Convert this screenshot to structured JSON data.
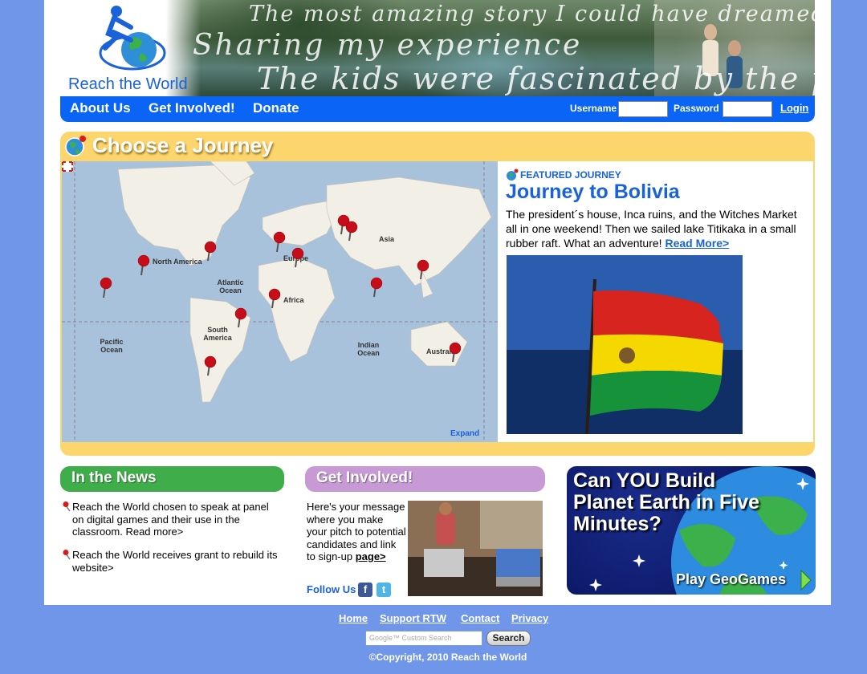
{
  "brand": {
    "name": "Reach the World"
  },
  "banner": {
    "tagline_1": "The most amazing story I could have dreamed of",
    "tagline_2": "Sharing my experience",
    "tagline_3": "The kids were fascinated by the person"
  },
  "nav": {
    "items": [
      "About Us",
      "Get Involved!",
      "Donate"
    ],
    "username_label": "Username",
    "password_label": "Password",
    "login_label": "Login"
  },
  "journey": {
    "title": "Choose a Journey",
    "map_labels": {
      "north_america": "North America",
      "atlantic": "Atlantic Ocean",
      "europe": "Europe",
      "asia": "Asia",
      "africa": "Africa",
      "south_america": "South America",
      "pacific": "Pacific Ocean",
      "indian": "Indian Ocean",
      "australia": "Australia"
    },
    "expand_label": "Expand",
    "featured": {
      "label": "FEATURED JOURNEY",
      "title": "Journey to Bolivia",
      "description": "The president´s house, Inca ruins, and the Witches Market all in one weekend! Then we sailed lake Titikaka in a small rubber raft. What an adventure!",
      "read_more": "Read More>"
    }
  },
  "news": {
    "title": "In the News",
    "items": [
      "Reach the World chosen to speak at panel on digital games and their use in the classroom. Read more>",
      "Reach the World receives grant to rebuild its website>"
    ]
  },
  "get_involved": {
    "title": "Get Involved!",
    "text": "Here's your message where you make your pitch to potential candidates and link to sign-up",
    "link": "page>",
    "follow": "Follow Us",
    "facebook": "f",
    "twitter": "t"
  },
  "geogames": {
    "title": "Can YOU Build Planet Earth in Five Minutes?",
    "cta": "Play GeoGames"
  },
  "footer": {
    "links": [
      "Home",
      "Support RTW",
      "Contact",
      "Privacy"
    ],
    "search_placeholder": "Google™ Custom Search",
    "search_button": "Search",
    "copyright": "©Copyright, 2010 Reach the World"
  },
  "colors": {
    "nav_blue": "#0a64f5",
    "journey_yellow": "#fdd56d",
    "news_green": "#3fae4a",
    "getinv_purple": "#c79ad6",
    "link_blue": "#1a62d8"
  }
}
